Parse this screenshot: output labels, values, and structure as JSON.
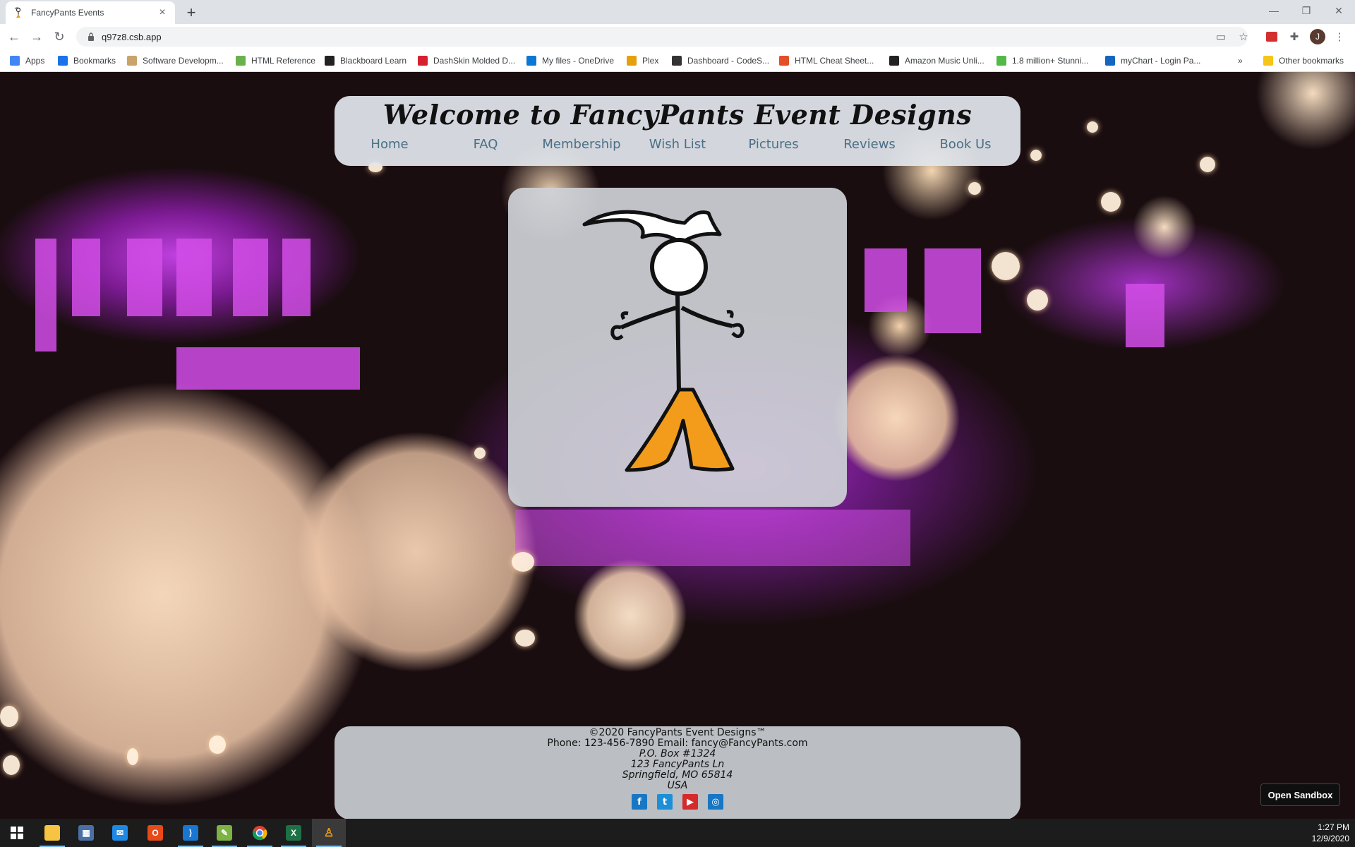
{
  "browser": {
    "tab_title": "FancyPants Events",
    "url": "q97z8.csb.app",
    "bookmarks": [
      {
        "label": "Apps",
        "icon": "apps-grid-icon",
        "color": "#4285f4"
      },
      {
        "label": "Bookmarks",
        "icon": "star-icon",
        "color": "#1a73e8"
      },
      {
        "label": "Software Developm...",
        "icon": "gear-icon",
        "color": "#c9a36b"
      },
      {
        "label": "HTML Reference",
        "icon": "w3-icon",
        "color": "#6ab04c"
      },
      {
        "label": "Blackboard Learn",
        "icon": "blackboard-icon",
        "color": "#222222"
      },
      {
        "label": "DashSkin Molded D...",
        "icon": "ds-icon",
        "color": "#d6202f"
      },
      {
        "label": "My files - OneDrive",
        "icon": "cloud-icon",
        "color": "#0a78d4"
      },
      {
        "label": "Plex",
        "icon": "plex-icon",
        "color": "#e5a00d"
      },
      {
        "label": "Dashboard - CodeS...",
        "icon": "codesandbox-icon",
        "color": "#333333"
      },
      {
        "label": "HTML Cheat Sheet...",
        "icon": "html5-icon",
        "color": "#e34f26"
      },
      {
        "label": "Amazon Music Unli...",
        "icon": "amazon-icon",
        "color": "#222222"
      },
      {
        "label": "1.8 million+ Stunni...",
        "icon": "px-icon",
        "color": "#54b847"
      },
      {
        "label": "myChart - Login Pa...",
        "icon": "mychart-icon",
        "color": "#1565c0"
      }
    ],
    "other_bookmarks": "Other bookmarks",
    "avatar_initial": "J"
  },
  "site": {
    "title": "Welcome to FancyPants Event Designs",
    "nav": [
      "Home",
      "FAQ",
      "Membership",
      "Wish List",
      "Pictures",
      "Reviews",
      "Book Us"
    ],
    "footer": {
      "copyright": "©2020 FancyPants Event Designs™",
      "contact": "Phone: 123-456-7890 Email: fancy@FancyPants.com",
      "address": [
        "P.O. Box #1324",
        "123 FancyPants Ln",
        "Springfield, MO 65814",
        "USA"
      ],
      "socials": [
        {
          "icon": "facebook-icon",
          "glyph": "f",
          "color": "#1877c4"
        },
        {
          "icon": "twitter-icon",
          "glyph": "t",
          "color": "#1d8fd6"
        },
        {
          "icon": "youtube-icon",
          "glyph": "▶",
          "color": "#d52b2b"
        },
        {
          "icon": "instagram-icon",
          "glyph": "◎",
          "color": "#1877c4"
        }
      ]
    },
    "open_sandbox": "Open Sandbox"
  },
  "taskbar": {
    "time": "1:27 PM",
    "date": "12/9/2020"
  }
}
